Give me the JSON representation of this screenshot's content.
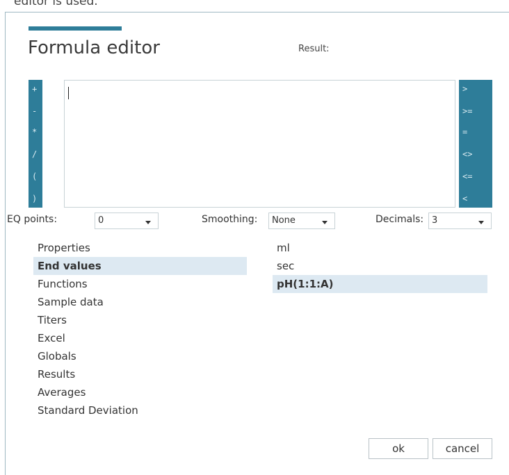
{
  "top_fragment": "editor is used.",
  "dialog": {
    "title": "Formula editor",
    "result_label": "Result:",
    "formula_value": ""
  },
  "operators_left": [
    "+",
    "-",
    "*",
    "/",
    "(",
    ")"
  ],
  "operators_right": [
    ">",
    ">=",
    "=",
    "<>",
    "<=",
    "<"
  ],
  "options": {
    "eq_points": {
      "label": "EQ points:",
      "value": "0"
    },
    "smoothing": {
      "label": "Smoothing:",
      "value": "None"
    },
    "decimals": {
      "label": "Decimals:",
      "value": "3"
    }
  },
  "categories": [
    {
      "label": "Properties",
      "selected": false
    },
    {
      "label": "End values",
      "selected": true
    },
    {
      "label": "Functions",
      "selected": false
    },
    {
      "label": "Sample data",
      "selected": false
    },
    {
      "label": "Titers",
      "selected": false
    },
    {
      "label": "Excel",
      "selected": false
    },
    {
      "label": "Globals",
      "selected": false
    },
    {
      "label": "Results",
      "selected": false
    },
    {
      "label": "Averages",
      "selected": false
    },
    {
      "label": "Standard Deviation",
      "selected": false
    }
  ],
  "values": [
    {
      "label": "ml",
      "selected": false
    },
    {
      "label": "sec",
      "selected": false
    },
    {
      "label": "pH(1:1:A)",
      "selected": true
    }
  ],
  "buttons": {
    "ok": "ok",
    "cancel": "cancel"
  },
  "colors": {
    "accent": "#2e7d99",
    "selection": "#dde9f2"
  }
}
